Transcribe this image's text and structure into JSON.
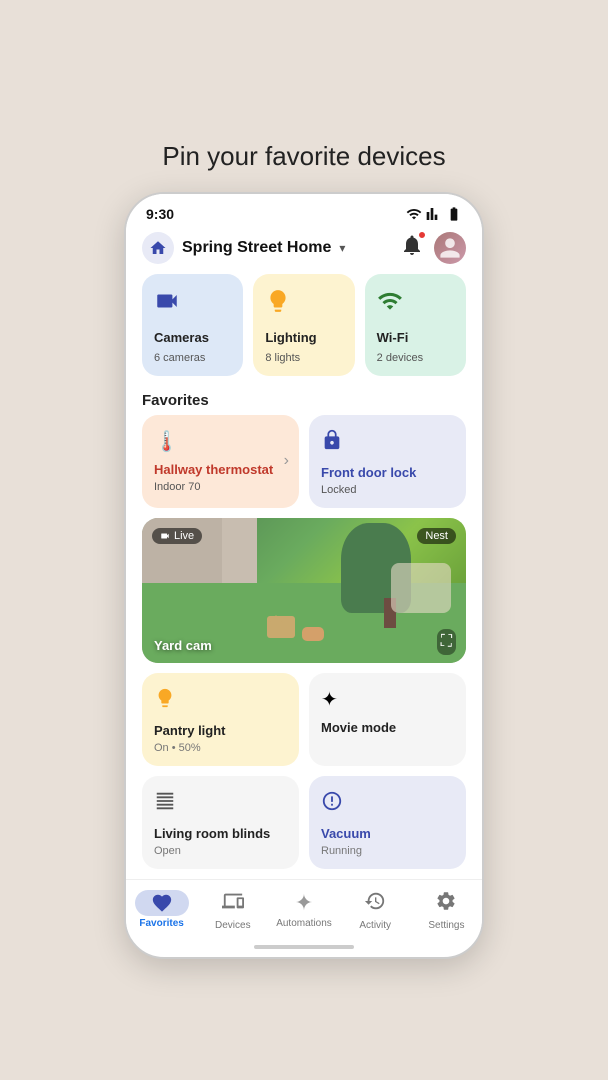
{
  "page": {
    "title": "Pin your favorite devices"
  },
  "statusBar": {
    "time": "9:30",
    "wifi": "wifi",
    "signal": "signal",
    "battery": "battery"
  },
  "header": {
    "homeIconAlt": "home-icon",
    "homeName": "Spring Street Home",
    "chevron": "▾",
    "bell": "🔔",
    "avatarLabel": "User"
  },
  "deviceCards": [
    {
      "icon": "📹",
      "name": "Cameras",
      "sub": "6 cameras",
      "color": "blue"
    },
    {
      "icon": "💡",
      "name": "Lighting",
      "sub": "8 lights",
      "color": "yellow"
    },
    {
      "icon": "📶",
      "name": "Wi-Fi",
      "sub": "2 devices",
      "color": "green"
    }
  ],
  "favoritesSection": {
    "label": "Favorites"
  },
  "favoriteCards": [
    {
      "icon": "🌡️",
      "name": "Hallway thermostat",
      "sub": "Indoor 70",
      "color": "orange",
      "textColor": "red",
      "hasArrow": true
    },
    {
      "icon": "🔒",
      "name": "Front door lock",
      "sub": "Locked",
      "color": "lavender",
      "textColor": "blue",
      "hasArrow": false
    }
  ],
  "camera": {
    "liveBadge": "Live",
    "nestBadge": "Nest",
    "name": "Yard cam",
    "expandIcon": "⛶"
  },
  "smartCards": [
    {
      "icon": "💡",
      "name": "Pantry light",
      "sub": "On • 50%",
      "color": "yellow-light"
    },
    {
      "icon": "✦",
      "name": "Movie mode",
      "sub": "",
      "color": "light-gray"
    }
  ],
  "bottomCards": [
    {
      "icon": "⊞",
      "name": "Living room blinds",
      "sub": "Open",
      "color": "white-card",
      "textColor": "dark"
    },
    {
      "icon": "🤖",
      "name": "Vacuum",
      "sub": "Running",
      "color": "lavender",
      "textColor": "blue"
    }
  ],
  "bottomNav": [
    {
      "icon": "♥",
      "label": "Favorites",
      "active": true
    },
    {
      "icon": "📱",
      "label": "Devices",
      "active": false
    },
    {
      "icon": "✦",
      "label": "Automations",
      "active": false
    },
    {
      "icon": "🕐",
      "label": "Activity",
      "active": false
    },
    {
      "icon": "⚙",
      "label": "Settings",
      "active": false
    }
  ]
}
